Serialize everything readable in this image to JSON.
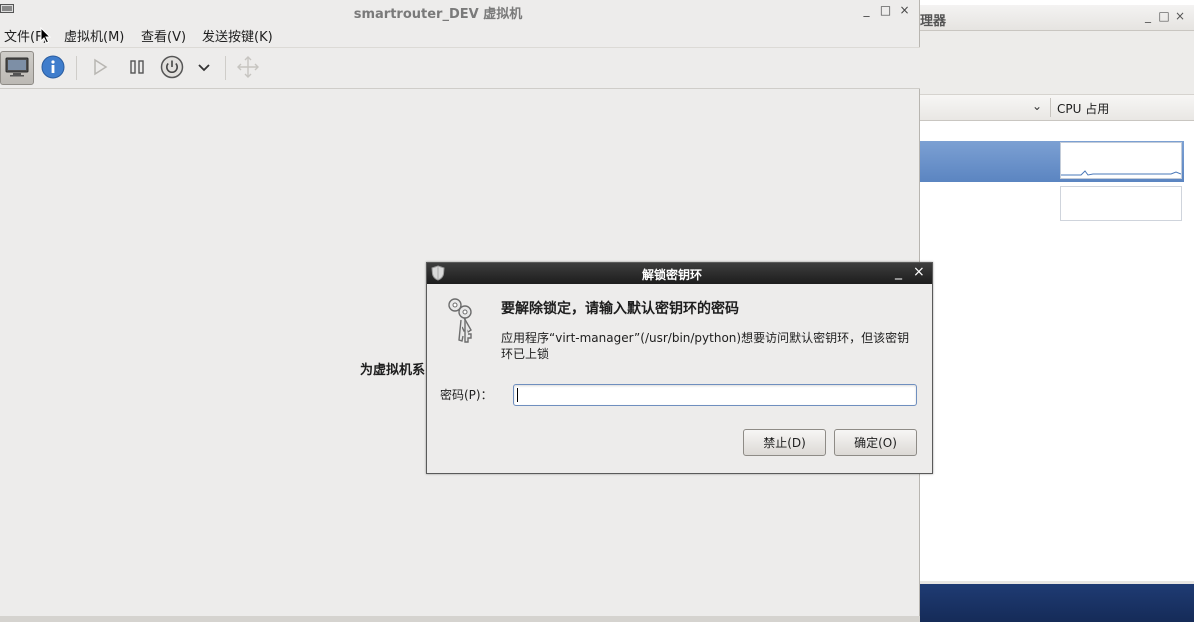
{
  "manager_window": {
    "title_fragment": "理器",
    "controls": [
      "_",
      "□",
      "×"
    ],
    "column_header": {
      "chevron": "⌄",
      "cpu_label": "CPU 占用"
    }
  },
  "vm_window": {
    "title": "smartrouter_DEV 虚拟机",
    "controls": [
      "_",
      "□",
      "×"
    ],
    "menu": {
      "file": "文件(F)",
      "vm": "虚拟机(M)",
      "view": "查看(V)",
      "sendkey": "发送按键(K)"
    },
    "toolbar": {
      "icons": [
        "console-icon",
        "info-icon",
        "run-icon",
        "pause-icon",
        "power-icon",
        "power-dropdown-icon",
        "fullscreen-icon"
      ]
    },
    "center_hint": "为虚拟机系"
  },
  "dialog": {
    "title": "解锁密钥环",
    "controls": [
      "_",
      "×"
    ],
    "heading": "要解除锁定，请输入默认密钥环的密码",
    "description": "应用程序“virt-manager”(/usr/bin/python)想要访问默认密钥环，但该密钥环已上锁",
    "password_label": "密码(P)：",
    "password_value": "",
    "deny_label": "禁止(D)",
    "ok_label": "确定(O)"
  },
  "colors": {
    "desktop_panel": "#1c3566",
    "selection": "#6a93cb",
    "dialog_titlebar": "#2a2a2a"
  }
}
